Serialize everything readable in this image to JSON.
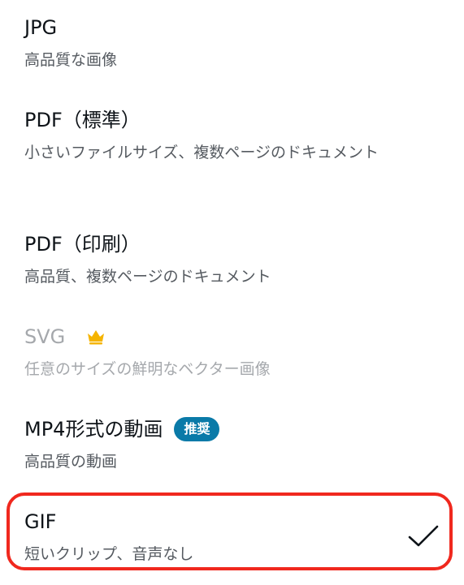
{
  "options": [
    {
      "title": "JPG",
      "description": "高品質な画像"
    },
    {
      "title": "PDF（標準）",
      "description": "小さいファイルサイズ、複数ページのドキュメント"
    },
    {
      "title": "PDF（印刷）",
      "description": "高品質、複数ページのドキュメント"
    },
    {
      "title": "SVG",
      "description": "任意のサイズの鮮明なベクター画像",
      "icon": "crown-icon",
      "icon_color": "#f5b400",
      "disabled": true
    },
    {
      "title": "MP4形式の動画",
      "description": "高品質の動画",
      "badge": "推奨",
      "badge_color": "#0a7aa8"
    },
    {
      "title": "GIF",
      "description": "短いクリップ、音声なし",
      "selected": true,
      "check_icon": "checkmark-icon",
      "highlight_color": "#f0281e"
    }
  ]
}
